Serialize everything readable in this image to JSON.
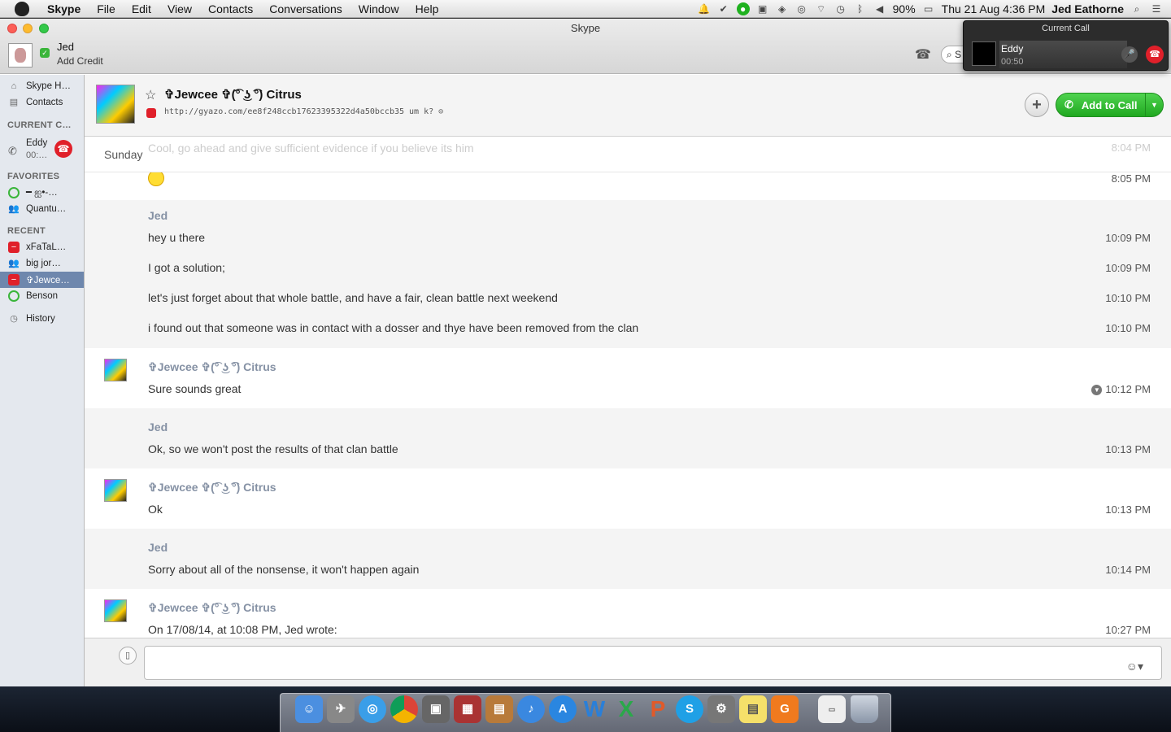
{
  "menubar": {
    "app_name": "Skype",
    "menus": [
      "File",
      "Edit",
      "View",
      "Contacts",
      "Conversations",
      "Window",
      "Help"
    ],
    "battery": "90%",
    "datetime": "Thu 21 Aug  4:36 PM",
    "user": "Jed Eathorne"
  },
  "window": {
    "title": "Skype",
    "profile_name": "Jed",
    "profile_credit": "Add Credit",
    "search_text": "S"
  },
  "sidebar": {
    "home": "Skype H…",
    "contacts": "Contacts",
    "current_header": "CURRENT C…",
    "current_call": {
      "name": "Eddy",
      "time": "00:…"
    },
    "favorites_header": "FAVORITES",
    "favorites": [
      "━ ஐ•-…",
      "Quantu…"
    ],
    "recent_header": "RECENT",
    "recent": [
      "xFaTaL…",
      "big jor…",
      "✞Jewce…",
      "Benson"
    ],
    "history": "History"
  },
  "chat_header": {
    "contact_name": "✞Jewcee ✞(͡° ͜ʖ ͡°) Citrus",
    "mood": "http://gyazo.com/ee8f248ccb17623395322d4a50bccb35 um k?",
    "add_to_call": "Add to Call"
  },
  "conversation": {
    "day": "Sunday",
    "faded_message": "Cool, go ahead and give sufficient evidence if you believe its him",
    "faded_time": "8:04 PM",
    "emoji_time": "8:05 PM",
    "blocks": [
      {
        "sender": "Jed",
        "messages": [
          {
            "text": "hey u there",
            "time": "10:09 PM"
          },
          {
            "text": "I got a solution;",
            "time": "10:09 PM"
          },
          {
            "text": "let's just forget about that whole battle, and have a fair, clean battle next weekend",
            "time": "10:10 PM"
          },
          {
            "text": "i found out that someone was in contact with a dosser and thye have been removed from the clan",
            "time": "10:10 PM"
          }
        ]
      },
      {
        "sender": "✞Jewcee ✞(͡° ͜ʖ ͡°) Citrus",
        "messages": [
          {
            "text": "Sure sounds great",
            "time": "10:12 PM"
          }
        ]
      },
      {
        "sender": "Jed",
        "messages": [
          {
            "text": "Ok, so we won't post the results of that clan battle",
            "time": "10:13 PM"
          }
        ]
      },
      {
        "sender": "✞Jewcee ✞(͡° ͜ʖ ͡°) Citrus",
        "messages": [
          {
            "text": "Ok",
            "time": "10:13 PM"
          }
        ]
      },
      {
        "sender": "Jed",
        "messages": [
          {
            "text": "Sorry about all of the nonsense, it won't happen again",
            "time": "10:14 PM"
          }
        ]
      },
      {
        "sender": "✞Jewcee ✞(͡° ͜ʖ ͡°) Citrus",
        "messages": [
          {
            "text": "On 17/08/14, at 10:08 PM, Jed wrote:",
            "time": "10:27 PM"
          }
        ]
      }
    ]
  },
  "call_panel": {
    "title": "Current Call",
    "name": "Eddy",
    "time": "00:50"
  },
  "colors": {
    "accent_green": "#2dbd2d",
    "end_call_red": "#e0202a",
    "sidebar_selection": "#6e87ad",
    "sender_name": "#8591a4"
  }
}
